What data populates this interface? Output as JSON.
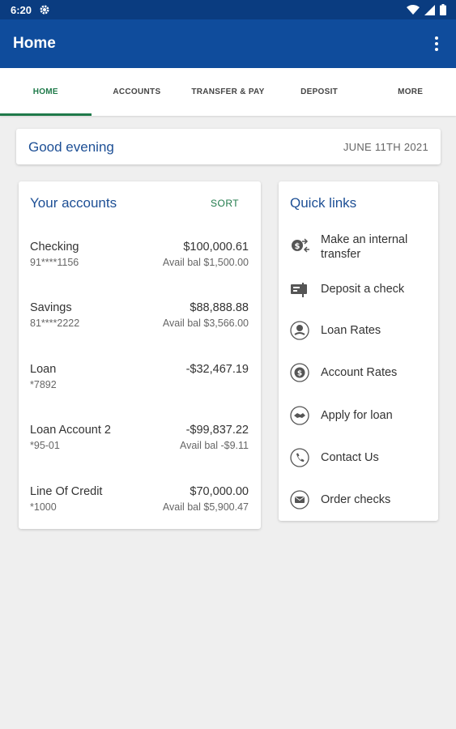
{
  "status": {
    "time": "6:20"
  },
  "appbar": {
    "title": "Home"
  },
  "tabs": [
    {
      "label": "HOME",
      "active": true
    },
    {
      "label": "ACCOUNTS"
    },
    {
      "label": "TRANSFER & PAY"
    },
    {
      "label": "DEPOSIT"
    },
    {
      "label": "MORE"
    }
  ],
  "greeting": {
    "text": "Good evening",
    "date": "JUNE 11TH 2021"
  },
  "accounts": {
    "title": "Your accounts",
    "sort_label": "SORT",
    "items": [
      {
        "name": "Checking",
        "number": "91****1156",
        "balance": "$100,000.61",
        "avail": "Avail bal $1,500.00"
      },
      {
        "name": "Savings",
        "number": "81****2222",
        "balance": "$88,888.88",
        "avail": "Avail bal $3,566.00"
      },
      {
        "name": "Loan",
        "number": "*7892",
        "balance": "-$32,467.19",
        "avail": ""
      },
      {
        "name": "Loan Account 2",
        "number": "*95-01",
        "balance": "-$99,837.22",
        "avail": "Avail bal -$9.11"
      },
      {
        "name": "Line Of Credit",
        "number": "*1000",
        "balance": "$70,000.00",
        "avail": "Avail bal $5,900.47"
      }
    ]
  },
  "quick_links": {
    "title": "Quick links",
    "items": [
      {
        "label": "Make an internal transfer",
        "icon": "transfer-icon"
      },
      {
        "label": "Deposit a check",
        "icon": "deposit-check-icon"
      },
      {
        "label": "Loan Rates",
        "icon": "loan-rates-icon"
      },
      {
        "label": "Account Rates",
        "icon": "account-rates-icon"
      },
      {
        "label": "Apply for loan",
        "icon": "handshake-icon"
      },
      {
        "label": "Contact Us",
        "icon": "phone-icon"
      },
      {
        "label": "Order checks",
        "icon": "envelope-icon"
      }
    ]
  },
  "colors": {
    "primary": "#0f4c9c",
    "status_bar": "#0a3c80",
    "accent_green": "#1f7a4a",
    "title_blue": "#1d4f95"
  }
}
